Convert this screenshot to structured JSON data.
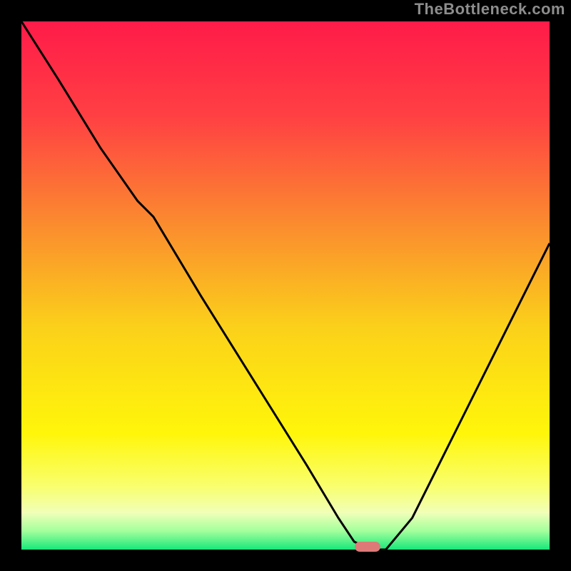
{
  "watermark": "TheBottleneck.com",
  "colors": {
    "frame": "#000000",
    "watermark_text": "#8d8d8d",
    "gradient_stops": [
      {
        "offset": 0.0,
        "color": "#ff1b49"
      },
      {
        "offset": 0.18,
        "color": "#ff4043"
      },
      {
        "offset": 0.38,
        "color": "#fb8a2f"
      },
      {
        "offset": 0.58,
        "color": "#fbd11a"
      },
      {
        "offset": 0.78,
        "color": "#fff60a"
      },
      {
        "offset": 0.88,
        "color": "#f9ff6d"
      },
      {
        "offset": 0.93,
        "color": "#f1ffb8"
      },
      {
        "offset": 0.965,
        "color": "#a3ff9c"
      },
      {
        "offset": 1.0,
        "color": "#17e87a"
      }
    ],
    "curve": "#000000",
    "marker": "#dd7a78"
  },
  "marker": {
    "x_frac": 0.655,
    "y_frac": 0.994
  },
  "chart_data": {
    "type": "line",
    "title": "",
    "xlabel": "",
    "ylabel": "",
    "xlim": [
      0,
      1
    ],
    "ylim": [
      0,
      1
    ],
    "series": [
      {
        "name": "bottleneck-curve",
        "x": [
          0.0,
          0.07,
          0.15,
          0.22,
          0.25,
          0.34,
          0.44,
          0.54,
          0.6,
          0.63,
          0.66,
          0.69,
          0.74,
          0.8,
          0.86,
          0.92,
          1.0
        ],
        "y": [
          0.0,
          0.11,
          0.24,
          0.34,
          0.37,
          0.52,
          0.68,
          0.84,
          0.94,
          0.985,
          1.0,
          1.0,
          0.94,
          0.82,
          0.7,
          0.58,
          0.42
        ]
      }
    ],
    "annotations": [
      {
        "type": "marker",
        "x": 0.655,
        "y": 0.994,
        "label": "optimal-point"
      }
    ]
  }
}
